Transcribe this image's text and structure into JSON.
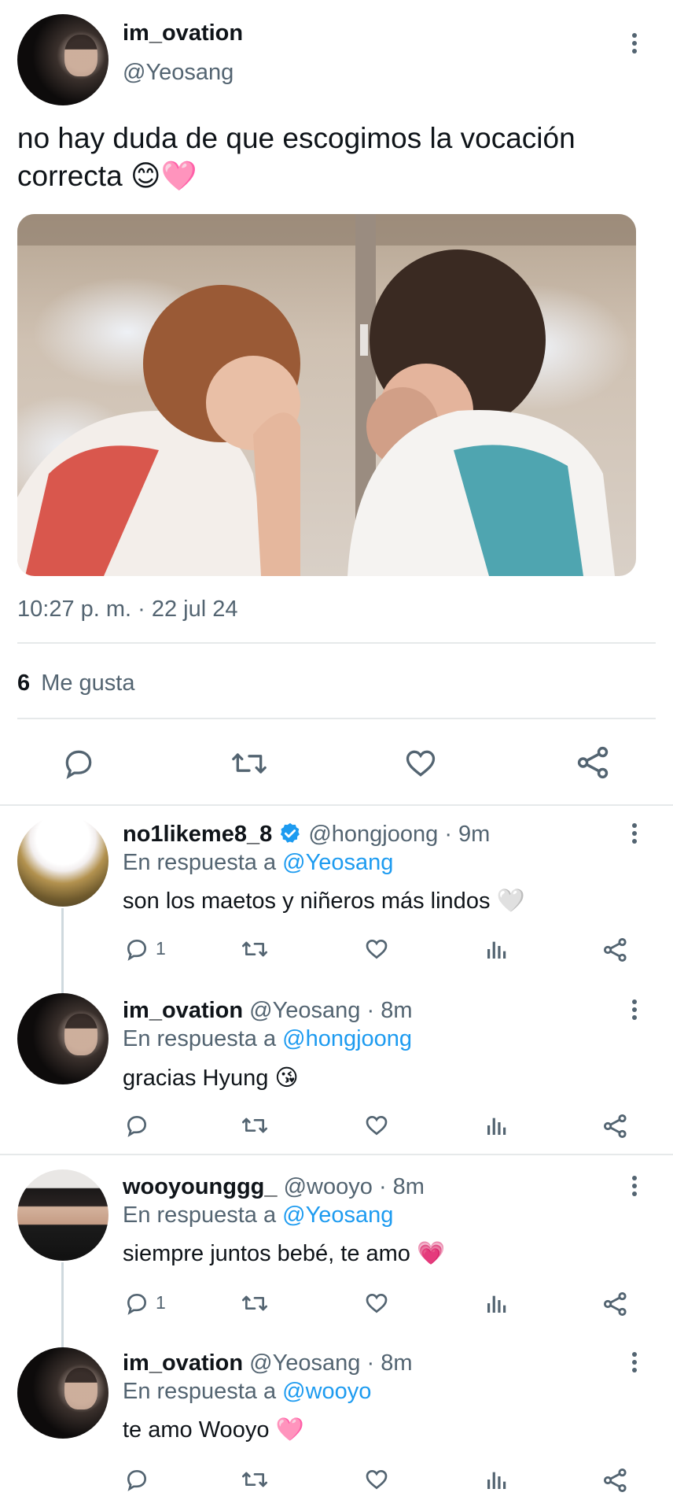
{
  "main_tweet": {
    "display_name": "im_ovation",
    "handle": "@Yeosang",
    "text": "no hay duda de que escogimos la vocación correcta",
    "text_line1": "no hay duda de que escogimos la vocación",
    "text_line2": "correcta",
    "emoji": "😊🩷",
    "timestamp": "10:27 p. m. · 22 jul 24",
    "likes_count": "6",
    "likes_label": "Me gusta",
    "actions": [
      "reply-icon",
      "retweet-icon",
      "like-icon",
      "share-icon"
    ]
  },
  "replies": [
    {
      "display_name": "no1likeme8_8",
      "verified": true,
      "handle": "@hongjoong",
      "time": "· 9m",
      "reply_prefix": "En respuesta a",
      "reply_to": "@Yeosang",
      "text": "son los maetos y niñeros más lindos",
      "emoji": "🤍",
      "reply_count": "1"
    },
    {
      "display_name": "im_ovation",
      "verified": false,
      "handle": "@Yeosang",
      "time": "· 8m",
      "reply_prefix": "En respuesta a",
      "reply_to": "@hongjoong",
      "text": "gracias Hyung",
      "emoji": "😘",
      "reply_count": ""
    },
    {
      "display_name": "wooyounggg_",
      "verified": false,
      "handle": "@wooyo",
      "time": "· 8m",
      "reply_prefix": "En respuesta a",
      "reply_to": "@Yeosang",
      "text": "siempre juntos bebé, te amo",
      "emoji": "💗",
      "reply_count": "1"
    },
    {
      "display_name": "im_ovation",
      "verified": false,
      "handle": "@Yeosang",
      "time": "· 8m",
      "reply_prefix": "En respuesta a",
      "reply_to": "@wooyo",
      "text": "te amo Wooyo",
      "emoji": "🩷",
      "reply_count": ""
    }
  ],
  "colors": {
    "link": "#1d9bf0",
    "secondary_text": "#536471",
    "divider": "#e6e9ea",
    "vest_red": "#d9574d",
    "vest_teal": "#4fa5b0"
  }
}
